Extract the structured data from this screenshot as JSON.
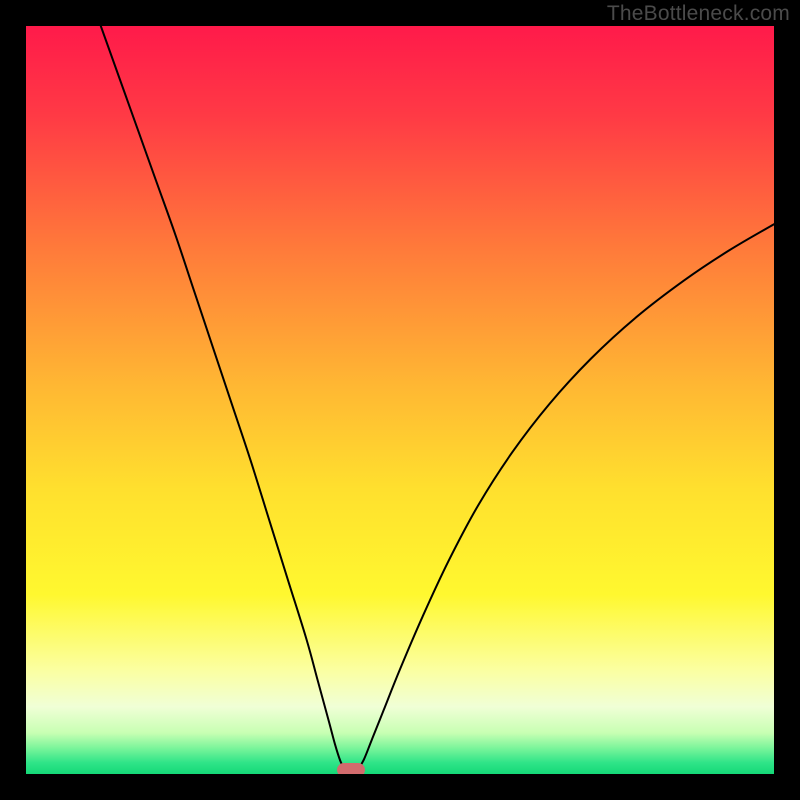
{
  "attribution": "TheBottleneck.com",
  "chart_data": {
    "type": "line",
    "title": "",
    "xlabel": "",
    "ylabel": "",
    "xlim": [
      0,
      100
    ],
    "ylim": [
      0,
      100
    ],
    "gradient_stops": [
      {
        "offset": 0.0,
        "color": "#ff1a4a"
      },
      {
        "offset": 0.12,
        "color": "#ff3a45"
      },
      {
        "offset": 0.3,
        "color": "#ff7b3a"
      },
      {
        "offset": 0.48,
        "color": "#ffb733"
      },
      {
        "offset": 0.62,
        "color": "#ffe02e"
      },
      {
        "offset": 0.76,
        "color": "#fff82f"
      },
      {
        "offset": 0.86,
        "color": "#fbffa0"
      },
      {
        "offset": 0.91,
        "color": "#f0ffd6"
      },
      {
        "offset": 0.945,
        "color": "#c8ffb3"
      },
      {
        "offset": 0.965,
        "color": "#7cf59b"
      },
      {
        "offset": 0.985,
        "color": "#2fe488"
      },
      {
        "offset": 1.0,
        "color": "#14d877"
      }
    ],
    "series": [
      {
        "name": "left",
        "x": [
          10.0,
          12.5,
          15.0,
          17.5,
          20.0,
          22.5,
          25.0,
          27.5,
          30.0,
          32.5,
          35.0,
          37.5,
          39.0,
          40.5,
          41.3,
          42.0,
          42.6
        ],
        "y": [
          100.0,
          93.0,
          86.0,
          79.0,
          72.0,
          64.5,
          57.0,
          49.5,
          42.0,
          34.0,
          26.0,
          18.0,
          12.5,
          7.0,
          4.0,
          1.8,
          0.6
        ]
      },
      {
        "name": "right",
        "x": [
          44.4,
          45.2,
          46.2,
          47.8,
          50.0,
          53.0,
          56.5,
          60.5,
          65.0,
          70.0,
          75.5,
          81.5,
          88.0,
          94.0,
          100.0
        ],
        "y": [
          0.6,
          2.0,
          4.5,
          8.5,
          14.0,
          21.0,
          28.5,
          36.0,
          43.0,
          49.5,
          55.5,
          61.0,
          66.0,
          70.0,
          73.5
        ]
      }
    ],
    "marker": {
      "x": 43.5,
      "y": 0.5,
      "color": "#d26b6d"
    }
  }
}
